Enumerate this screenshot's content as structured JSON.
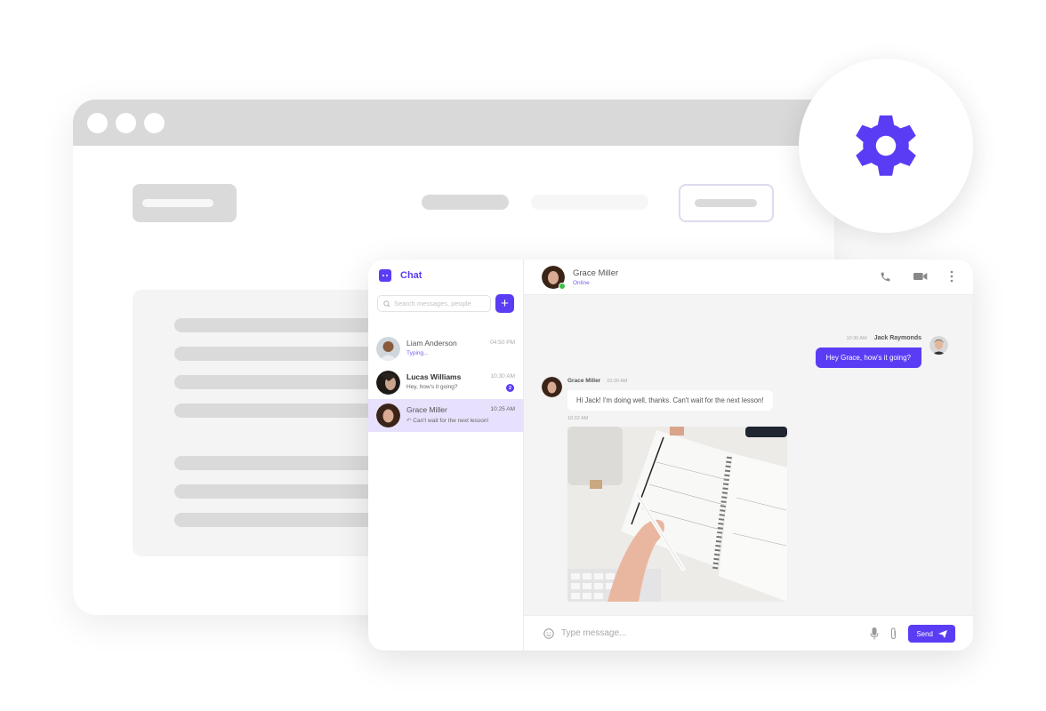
{
  "colors": {
    "accent": "#5b3cf5",
    "online": "#3bc14a",
    "active_conversation": "#e7e1fd"
  },
  "sidebar": {
    "brand_icon": "chat-bubble-icon",
    "brand_label": "Chat",
    "search": {
      "placeholder": "Search messages, people",
      "value": ""
    },
    "add_button_icon": "plus-icon",
    "conversations": [
      {
        "name": "Liam Anderson",
        "preview": "Typing...",
        "time": "04:50 PM",
        "typing": true,
        "unread": null,
        "active": false
      },
      {
        "name": "Lucas Williams",
        "preview": "Hey, how's it going?",
        "time": "10:30 AM",
        "typing": false,
        "unread": "2",
        "active": false
      },
      {
        "name": "Grace Miller",
        "preview": "Can't wait for the next lesson!",
        "time": "10:25 AM",
        "typing": false,
        "unread": null,
        "active": true,
        "replied_icon": "reply-icon"
      }
    ]
  },
  "header": {
    "contact_name": "Grace Miller",
    "contact_status": "Online",
    "actions": [
      "phone-icon",
      "video-camera-icon",
      "more-vertical-icon"
    ]
  },
  "messages": [
    {
      "direction": "out",
      "sender": "Jack Raymonds",
      "time": "10:30 AM",
      "text": "Hey Grace, how's it going?"
    },
    {
      "direction": "in",
      "sender": "Grace Miller",
      "time": "10:30 AM",
      "text": "Hi Jack! I'm doing well, thanks. Can't wait for the next lesson!"
    },
    {
      "direction": "in",
      "sender": "Grace Miller",
      "time": "10:32 AM",
      "attachment": "photo of planner notebook with hand holding pen"
    }
  ],
  "composer": {
    "emoji_icon": "emoji-icon",
    "placeholder": "Type message...",
    "value": "",
    "mic_icon": "microphone-icon",
    "attach_icon": "paperclip-icon",
    "send_label": "Send",
    "send_icon": "paper-plane-icon"
  },
  "settings_badge_icon": "gear-icon"
}
